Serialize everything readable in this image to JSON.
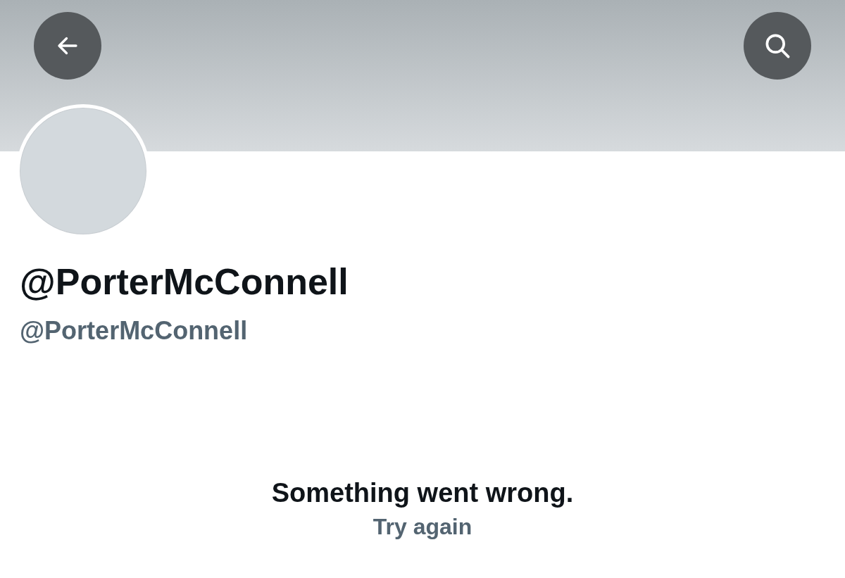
{
  "profile": {
    "display_name": "@PorterMcConnell",
    "handle": "@PorterMcConnell"
  },
  "error": {
    "message": "Something went wrong.",
    "retry": "Try again"
  }
}
